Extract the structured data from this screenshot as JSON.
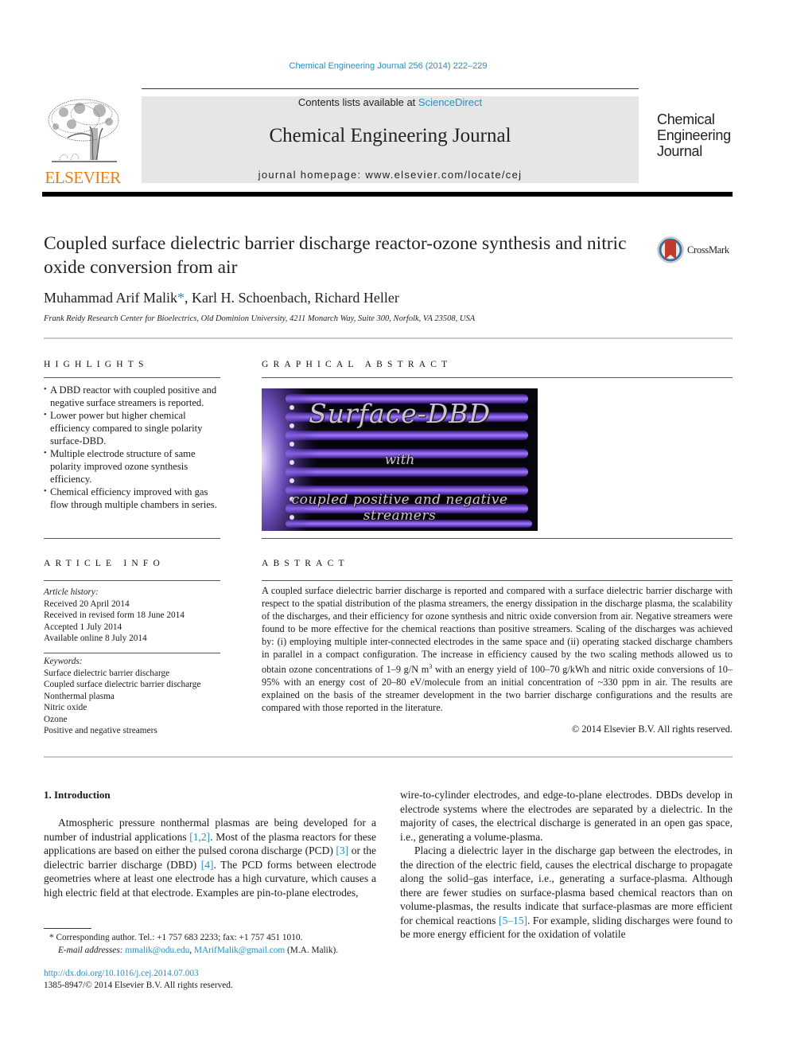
{
  "header": {
    "citation": "Chemical Engineering Journal 256 (2014) 222–229",
    "contents_prefix": "Contents lists available at ",
    "contents_link": "ScienceDirect",
    "journal_title": "Chemical Engineering Journal",
    "homepage": "journal homepage: www.elsevier.com/locate/cej",
    "publisher_wordmark": "ELSEVIER",
    "journal_logo_lines": [
      "Chemical",
      "Engineering",
      "Journal"
    ],
    "crossmark_label": "CrossMark"
  },
  "article": {
    "title": "Coupled surface dielectric barrier discharge reactor-ozone synthesis and nitric oxide conversion from air",
    "authors": [
      {
        "name": "Muhammad Arif Malik",
        "marker": "*"
      },
      {
        "name": ", Karl H. Schoenbach, Richard Heller",
        "marker": ""
      }
    ],
    "affiliation": "Frank Reidy Research Center for Bioelectrics, Old Dominion University, 4211 Monarch Way, Suite 300, Norfolk, VA 23508, USA"
  },
  "highlights": {
    "heading": "HIGHLIGHTS",
    "items": [
      "A DBD reactor with coupled positive and negative surface streamers is reported.",
      "Lower power but higher chemical efficiency compared to single polarity surface-DBD.",
      "Multiple electrode structure of same polarity improved ozone synthesis efficiency.",
      "Chemical efficiency improved with gas flow through multiple chambers in series."
    ]
  },
  "graphical_abstract": {
    "heading": "GRAPHICAL ABSTRACT",
    "image_title": "Surface-DBD",
    "image_with": "with",
    "image_subtitle": "coupled positive and negative streamers"
  },
  "article_info": {
    "heading": "ARTICLE INFO",
    "history_label": "Article history:",
    "history": [
      "Received 20 April 2014",
      "Received in revised form 18 June 2014",
      "Accepted 1 July 2014",
      "Available online 8 July 2014"
    ],
    "keywords_label": "Keywords:",
    "keywords": [
      "Surface dielectric barrier discharge",
      "Coupled surface dielectric barrier discharge",
      "Nonthermal plasma",
      "Nitric oxide",
      "Ozone",
      "Positive and negative streamers"
    ]
  },
  "abstract": {
    "heading": "ABSTRACT",
    "text_before_sup": "A coupled surface dielectric barrier discharge is reported and compared with a surface dielectric barrier discharge with respect to the spatial distribution of the plasma streamers, the energy dissipation in the discharge plasma, the scalability of the discharges, and their efficiency for ozone synthesis and nitric oxide conversion from air. Negative streamers were found to be more effective for the chemical reactions than positive streamers. Scaling of the discharges was achieved by: (i) employing multiple inter-connected electrodes in the same space and (ii) operating stacked discharge chambers in parallel in a compact configuration. The increase in efficiency caused by the two scaling methods allowed us to obtain ozone concentrations of 1–9 g/N m",
    "sup": "3",
    "text_after_sup": " with an energy yield of 100–70 g/kWh and nitric oxide conversions of 10–95% with an energy cost of 20–80 eV/molecule from an initial concentration of ~330 ppm in air. The results are explained on the basis of the streamer development in the two barrier discharge configurations and the results are compared with those reported in the literature.",
    "copyright": "© 2014 Elsevier B.V. All rights reserved."
  },
  "introduction": {
    "heading": "1. Introduction",
    "left": [
      {
        "t": "Atmospheric pressure nonthermal plasmas are being developed for a number of industrial applications "
      },
      {
        "ref": "[1,2]"
      },
      {
        "t": ". Most of the plasma reactors for these applications are based on either the pulsed corona discharge (PCD) "
      },
      {
        "ref": "[3]"
      },
      {
        "t": " or the dielectric barrier discharge (DBD) "
      },
      {
        "ref": "[4]"
      },
      {
        "t": ". The PCD forms between electrode geometries where at least one electrode has a high curvature, which causes a high electric field at that electrode. Examples are pin-to-plane electrodes,"
      }
    ],
    "right_p1": "wire-to-cylinder electrodes, and edge-to-plane electrodes. DBDs develop in electrode systems where the electrodes are separated by a dielectric. In the majority of cases, the electrical discharge is generated in an open gas space, i.e., generating a volume-plasma.",
    "right_p2_before": "Placing a dielectric layer in the discharge gap between the electrodes, in the direction of the electric field, causes the electrical discharge to propagate along the solid–gas interface, i.e., generating a surface-plasma. Although there are fewer studies on surface-plasma based chemical reactors than on volume-plasmas, the results indicate that surface-plasmas are more efficient for chemical reactions ",
    "right_p2_ref": "[5–15]",
    "right_p2_after": ". For example, sliding discharges were found to be more energy efficient for the oxidation of volatile"
  },
  "footnote": {
    "marker": "*",
    "corresponding": " Corresponding author. Tel.: +1 757 683 2233; fax: +1 757 451 1010.",
    "email_label": "E-mail addresses: ",
    "email1": "mmalik@odu.edu",
    "sep": ", ",
    "email2": "MArifMalik@gmail.com",
    "email_suffix": " (M.A. Malik).",
    "doi": "http://dx.doi.org/10.1016/j.cej.2014.07.003",
    "issn_line": "1385-8947/© 2014 Elsevier B.V. All rights reserved."
  },
  "colors": {
    "link": "#2a8fc1",
    "elsevier_orange": "#f07b10",
    "masthead_bg": "#e6e6e6",
    "plasma_purple": "#7a4fd8"
  }
}
